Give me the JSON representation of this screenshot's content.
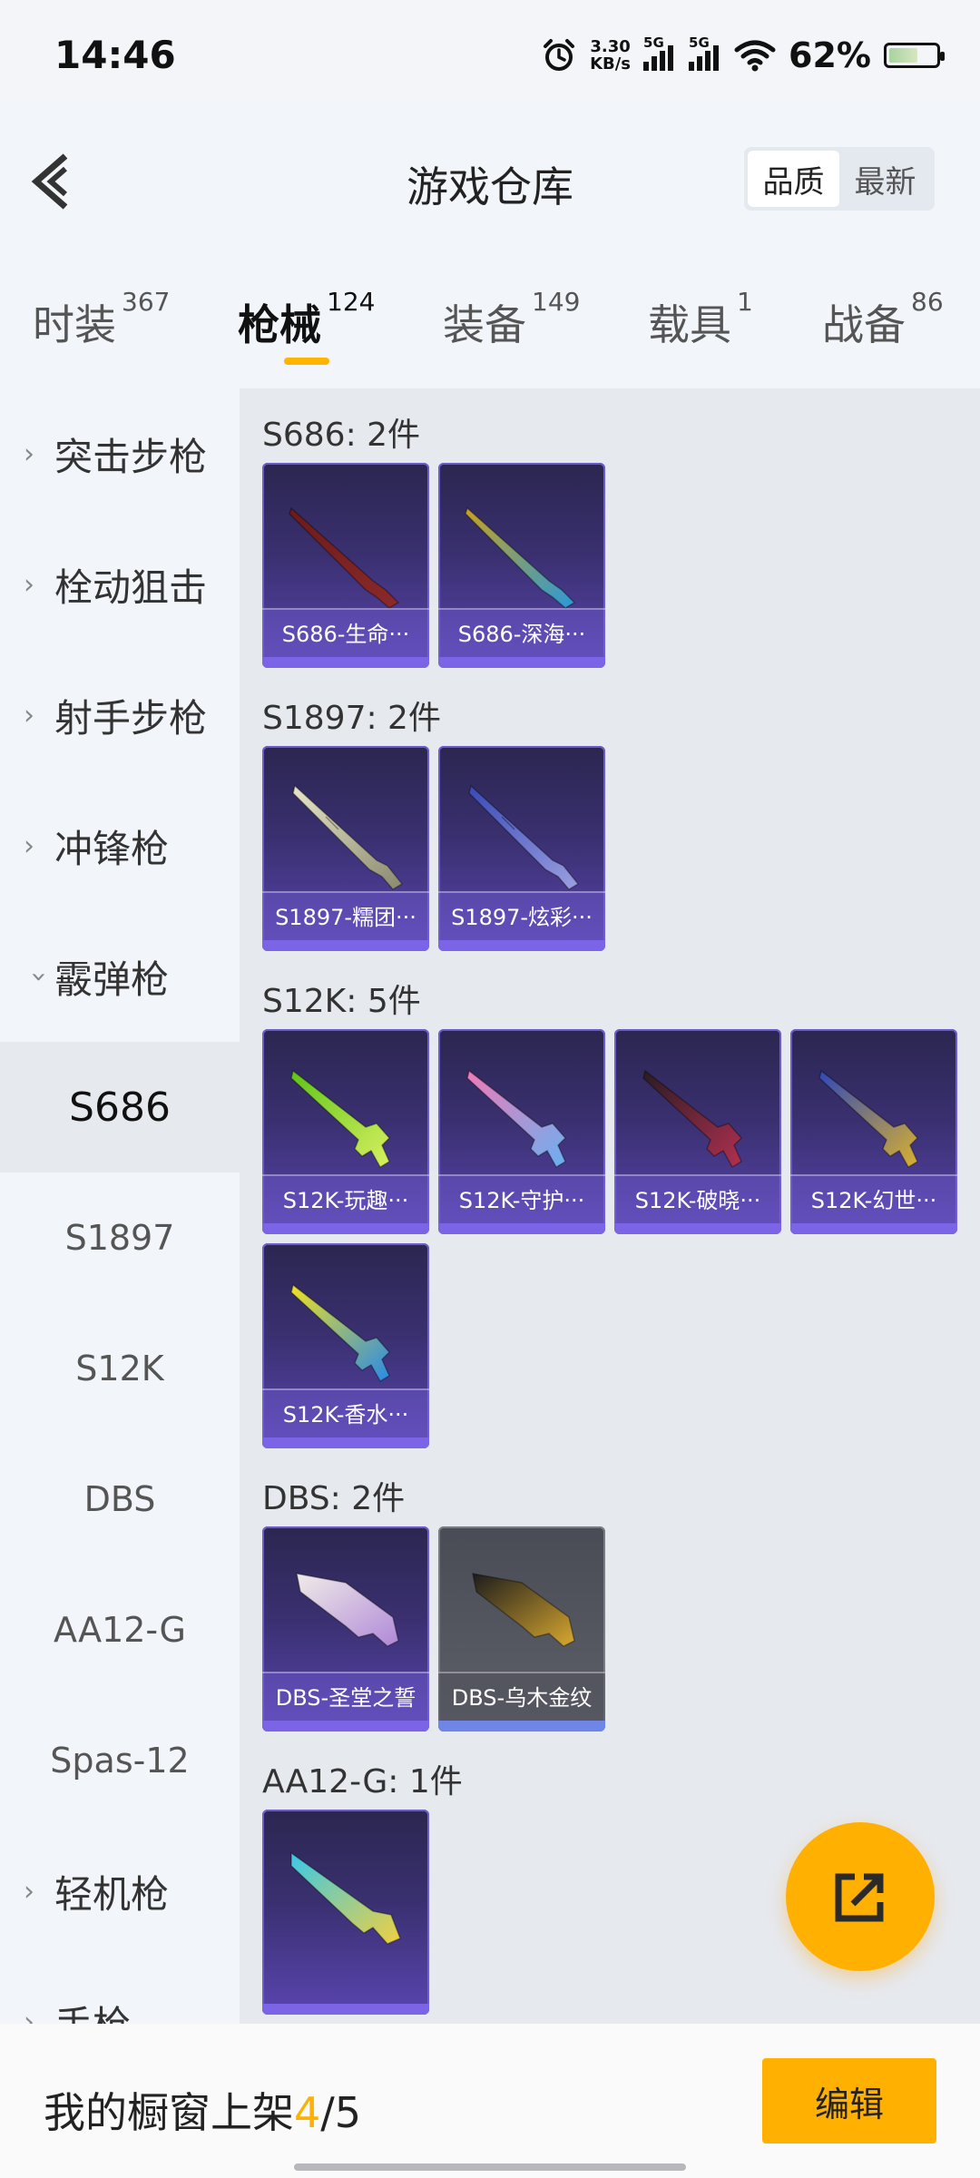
{
  "status_bar": {
    "time": "14:46",
    "net_speed_value": "3.30",
    "net_speed_unit": "KB/s",
    "sim1_label": "5G",
    "sim2_label": "5G",
    "battery": "62%",
    "battery_level": 0.62
  },
  "header": {
    "title": "游戏仓库",
    "sort_options": [
      "品质",
      "最新"
    ],
    "sort_active": "品质"
  },
  "tabs": [
    {
      "label": "时装",
      "count": "367"
    },
    {
      "label": "枪械",
      "count": "124",
      "active": true
    },
    {
      "label": "装备",
      "count": "149"
    },
    {
      "label": "载具",
      "count": "1"
    },
    {
      "label": "战备",
      "count": "86"
    }
  ],
  "sidebar": {
    "categories": [
      {
        "label": "突击步枪",
        "expanded": false
      },
      {
        "label": "栓动狙击",
        "expanded": false
      },
      {
        "label": "射手步枪",
        "expanded": false
      },
      {
        "label": "冲锋枪",
        "expanded": false
      },
      {
        "label": "霰弹枪",
        "expanded": true
      },
      {
        "label": "轻机枪",
        "expanded": false
      },
      {
        "label": "手枪",
        "expanded": false
      }
    ],
    "sub_items": [
      "S686",
      "S1897",
      "S12K",
      "DBS",
      "AA12-G",
      "Spas-12"
    ],
    "sub_active": "S686"
  },
  "groups": [
    {
      "title": "S686: 2件",
      "items": [
        {
          "name": "S686-生命···",
          "icon": "shotgun-double-barrel-icon",
          "colors": [
            "#6b1a1a",
            "#8b2a2a"
          ]
        },
        {
          "name": "S686-深海···",
          "icon": "shotgun-double-barrel-icon",
          "colors": [
            "#c9a020",
            "#2a9ad8"
          ]
        }
      ]
    },
    {
      "title": "S1897: 2件",
      "items": [
        {
          "name": "S1897-糯团···",
          "icon": "pump-shotgun-icon",
          "colors": [
            "#e8e4c8",
            "#8a8a70"
          ]
        },
        {
          "name": "S1897-炫彩···",
          "icon": "pump-shotgun-icon",
          "colors": [
            "#3a4ab8",
            "#9aa0e0"
          ]
        }
      ]
    },
    {
      "title": "S12K: 5件",
      "items": [
        {
          "name": "S12K-玩趣···",
          "icon": "assault-shotgun-icon",
          "colors": [
            "#5fc41a",
            "#d8f060"
          ]
        },
        {
          "name": "S12K-守护···",
          "icon": "assault-shotgun-icon",
          "colors": [
            "#f07ab8",
            "#6ab0f0"
          ]
        },
        {
          "name": "S12K-破晓···",
          "icon": "assault-shotgun-icon",
          "colors": [
            "#2a1c22",
            "#b03050"
          ]
        },
        {
          "name": "S12K-幻世···",
          "icon": "assault-shotgun-icon",
          "colors": [
            "#3048b8",
            "#d8b030"
          ]
        },
        {
          "name": "S12K-香水···",
          "icon": "assault-shotgun-icon",
          "colors": [
            "#f0e020",
            "#2a8ae8"
          ]
        }
      ]
    },
    {
      "title": "DBS: 2件",
      "items": [
        {
          "name": "DBS-圣堂之誓",
          "icon": "bullpup-shotgun-icon",
          "colors": [
            "#f0ece8",
            "#b088d8"
          ],
          "variant": "purple"
        },
        {
          "name": "DBS-乌木金纹",
          "icon": "bullpup-shotgun-icon",
          "colors": [
            "#1c1c1c",
            "#d8a830"
          ],
          "variant": "gray"
        }
      ]
    },
    {
      "title": "AA12-G: 1件",
      "items": [
        {
          "name": "",
          "icon": "auto-shotgun-icon",
          "colors": [
            "#3ac8e8",
            "#f0d040"
          ]
        }
      ]
    }
  ],
  "fab": {
    "icon": "share-external-icon"
  },
  "bottom": {
    "showcase_label": "我的橱窗上架",
    "showcase_current": "4",
    "showcase_total": "/5",
    "edit_label": "编辑"
  },
  "colors": {
    "accent": "#ffb000",
    "card_purple": "#5a45b0",
    "card_gray": "#5d6069"
  }
}
